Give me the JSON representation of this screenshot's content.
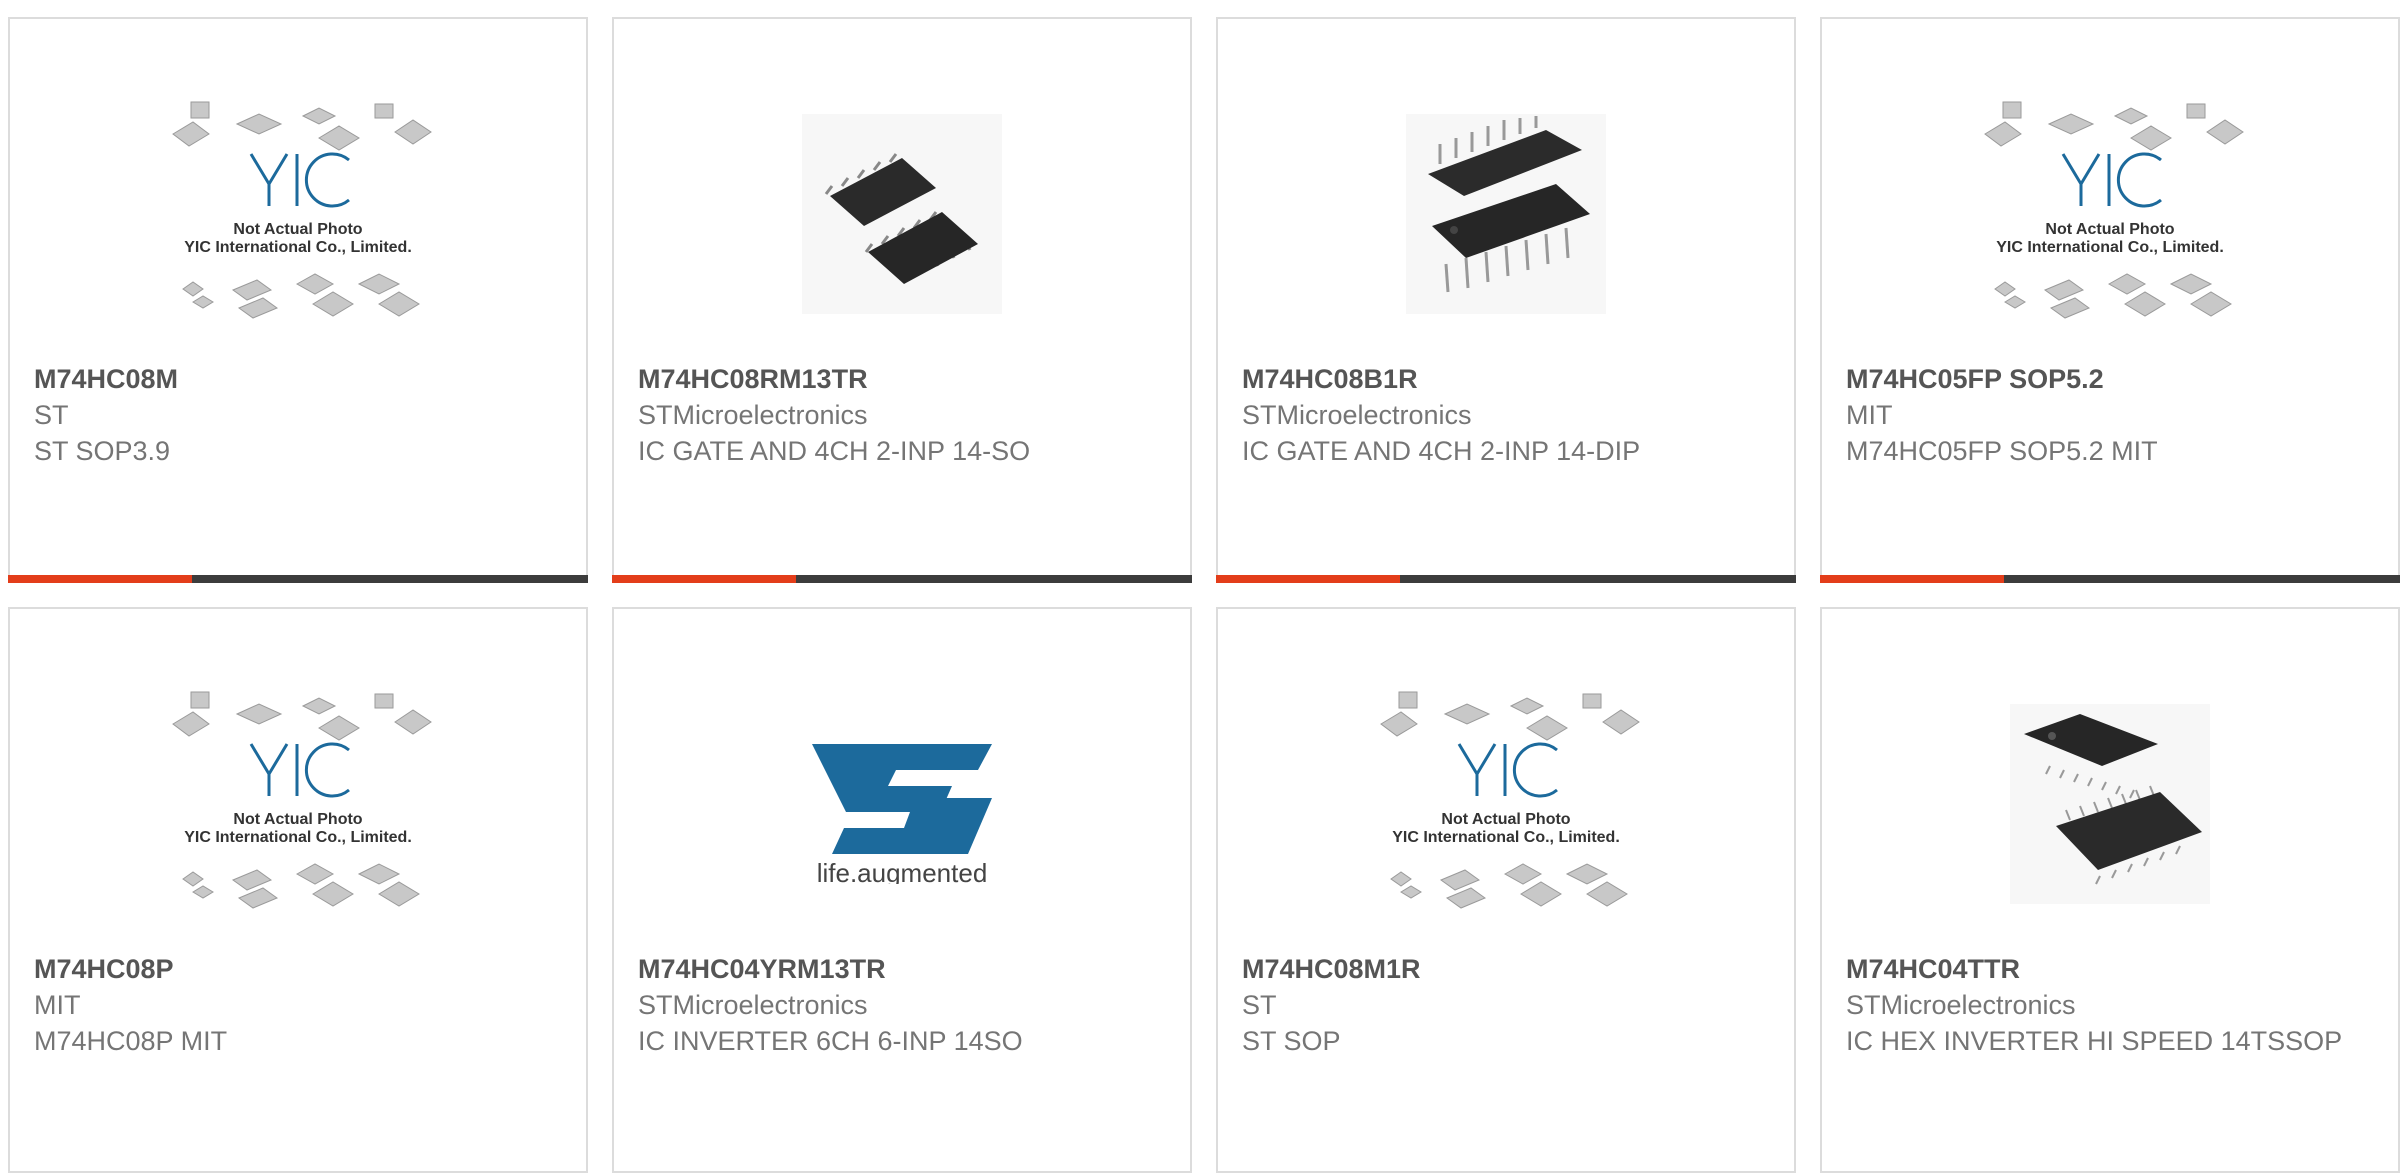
{
  "products": [
    {
      "part_number": "M74HC08M",
      "manufacturer": "ST",
      "description": "ST SOP3.9",
      "image": "yic-placeholder",
      "image_text": [
        "Not Actual Photo",
        "YIC International Co., Limited."
      ]
    },
    {
      "part_number": "M74HC08RM13TR",
      "manufacturer": "STMicroelectronics",
      "description": "IC GATE AND 4CH 2-INP 14-SO",
      "image": "soic-chip-photo"
    },
    {
      "part_number": "M74HC08B1R",
      "manufacturer": "STMicroelectronics",
      "description": "IC GATE AND 4CH 2-INP 14-DIP",
      "image": "dip-chip-photo"
    },
    {
      "part_number": "M74HC05FP SOP5.2",
      "manufacturer": "MIT",
      "description": "M74HC05FP SOP5.2 MIT",
      "image": "yic-placeholder",
      "image_text": [
        "Not Actual Photo",
        "YIC International Co., Limited."
      ]
    },
    {
      "part_number": "M74HC08P",
      "manufacturer": "MIT",
      "description": "M74HC08P MIT",
      "image": "yic-placeholder",
      "image_text": [
        "Not Actual Photo",
        "YIC International Co., Limited."
      ]
    },
    {
      "part_number": "M74HC04YRM13TR",
      "manufacturer": "STMicroelectronics",
      "description": "IC INVERTER 6CH 6-INP 14SO",
      "image": "st-logo",
      "logo_text": "life.augmented"
    },
    {
      "part_number": "M74HC08M1R",
      "manufacturer": "ST",
      "description": "ST SOP",
      "image": "yic-placeholder",
      "image_text": [
        "Not Actual Photo",
        "YIC International Co., Limited."
      ]
    },
    {
      "part_number": "M74HC04TTR",
      "manufacturer": "STMicroelectronics",
      "description": "IC HEX INVERTER HI SPEED 14TSSOP",
      "image": "tssop-chip-photo"
    }
  ],
  "colors": {
    "accent": "#e33d1a",
    "bar": "#3c3c3c",
    "border": "#dcdcdc",
    "text": "#757575",
    "title": "#555555",
    "st_blue": "#1c6a9c"
  }
}
